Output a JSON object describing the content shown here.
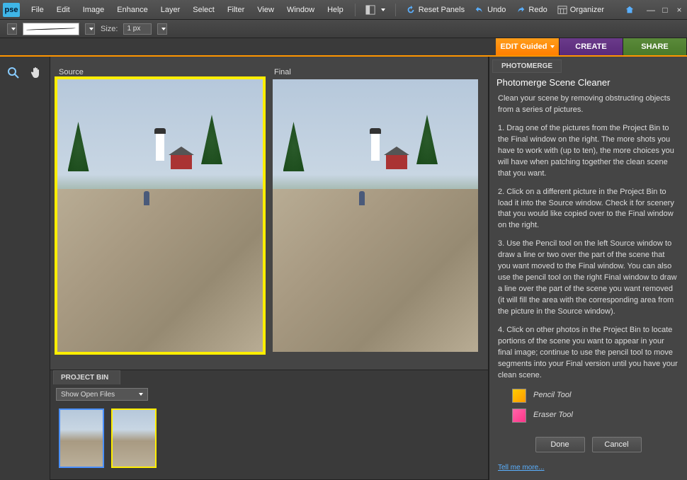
{
  "app": {
    "logo": "pse"
  },
  "menu": [
    "File",
    "Edit",
    "Image",
    "Enhance",
    "Layer",
    "Select",
    "Filter",
    "View",
    "Window",
    "Help"
  ],
  "top": {
    "reset": "Reset Panels",
    "undo": "Undo",
    "redo": "Redo",
    "organizer": "Organizer"
  },
  "options": {
    "size_label": "Size:",
    "size_value": "1 px"
  },
  "tabs": {
    "edit": "EDIT Guided",
    "create": "CREATE",
    "share": "SHARE"
  },
  "canvas": {
    "source_label": "Source",
    "final_label": "Final"
  },
  "project_bin": {
    "tab": "PROJECT BIN",
    "filter": "Show Open Files"
  },
  "panel": {
    "tab": "PHOTOMERGE",
    "title": "Photomerge Scene Cleaner",
    "intro": "Clean your scene by removing obstructing objects from a series of pictures.",
    "s1": "1. Drag one of the pictures from the Project Bin to the Final window on the right. The more shots you have to work with (up to ten), the more choices you will have when patching together the clean scene that you want.",
    "s2": "2. Click on a different picture in the Project Bin to load it into the Source window. Check it for scenery that you would like copied over to the Final window on the right.",
    "s3": "3. Use the Pencil tool on the left Source window to draw a line or two over the part of the scene that you want moved to the Final window. You can also use the pencil tool on the right Final window to draw a line over the part of the scene you want removed (it will fill the area with the corresponding area from the picture in the Source window).",
    "s4": "4. Click on other photos in the Project Bin to locate portions of the scene you want to appear in your final image; continue to use the pencil tool to move segments into your Final version until you have your clean scene.",
    "pencil": "Pencil Tool",
    "eraser": "Eraser Tool",
    "done": "Done",
    "cancel": "Cancel",
    "tell_more": "Tell me more..."
  }
}
